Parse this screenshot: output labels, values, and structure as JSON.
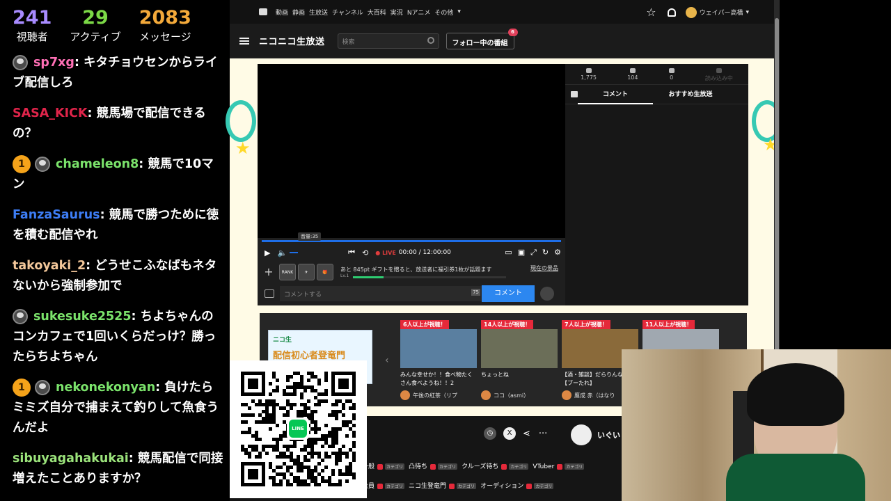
{
  "stats": [
    {
      "value": "241",
      "label": "視聴者",
      "color": "#a88bff"
    },
    {
      "value": "29",
      "label": "アクティブ",
      "color": "#7bd846"
    },
    {
      "value": "2083",
      "label": "メッセージ",
      "color": "#f3a93a"
    }
  ],
  "chat": [
    {
      "name": "sp7xg",
      "color": "#ff6fb5",
      "text": "キタチョウセンからライブ配信しろ",
      "badges": [
        "avatar"
      ]
    },
    {
      "name": "SASA_KICK",
      "color": "#e0244a",
      "text": "競馬場で配信できるの？",
      "badges": []
    },
    {
      "name": "chameleon8",
      "color": "#7be36b",
      "text": "競馬で10マン",
      "badges": [
        "1",
        "avatar"
      ]
    },
    {
      "name": "FanzaSaurus",
      "color": "#3d7df5",
      "text": "競馬で勝つために徳を積む配信やれ",
      "badges": []
    },
    {
      "name": "takoyaki_2",
      "color": "#f3c79a",
      "text": "どうせこふなばもネタないから強制参加で",
      "badges": []
    },
    {
      "name": "sukesuke2525",
      "color": "#7be36b",
      "text": "ちよちゃんのコンカフェで1回いくらだっけ？勝ったらちよちゃん",
      "badges": [
        "avatar"
      ]
    },
    {
      "name": "nekonekonyan",
      "color": "#7be36b",
      "text": "負けたらミミズ自分で捕まえて釣りして魚食うんだよ",
      "badges": [
        "1",
        "avatar"
      ]
    },
    {
      "name": "sibuyagahakukai",
      "color": "#9be37b",
      "text": "競馬配信で同接増えたことありますか？",
      "badges": []
    }
  ],
  "niconav": {
    "items": [
      "動画",
      "静画",
      "生放送",
      "チャンネル",
      "大百科",
      "実況",
      "Nアニメ",
      "その他"
    ],
    "user": "ウェイパー高橋"
  },
  "header": {
    "logo": "ニコニコ生放送",
    "search_placeholder": "検索",
    "follow_label": "フォロー中の番組",
    "follow_count": "6"
  },
  "player": {
    "volume_tip": "音量:35",
    "volume": 35,
    "live": "LIVE",
    "time": "00:00 / 12:00:00",
    "gift_text": "あと 845pt ギフトを贈ると、放送者に福引券1枚が話題ます",
    "gift_level": "Lv.1",
    "gift_now": "現在の景品",
    "comment_placeholder": "コメントする",
    "comment_count": "75",
    "comment_button": "コメント",
    "rank_label": "RANK"
  },
  "side": {
    "stats": [
      "1,775",
      "104",
      "0",
      "読み込み中"
    ],
    "tab_comment": "コメント",
    "tab_recommend": "おすすめ生放送"
  },
  "recs": {
    "ad_title": "ニコ生",
    "ad_sub": "配信初心者登竜門",
    "cards": [
      {
        "label": "6人以上が視聴！",
        "title": "みんな幸せか！！食べ物たくさん食べようね！！2",
        "user": "午後の紅茶（リプ",
        "thumb": "#5a7fa0"
      },
      {
        "label": "14人以上が視聴！",
        "title": "ちょっとね",
        "user": "ココ（asmi）",
        "thumb": "#6b6e58"
      },
      {
        "label": "7人以上が視聴！",
        "title": "【酒・雑談】だらりんなりん【ブーたれ】",
        "user": "鷹成 赤（はなり",
        "thumb": "#8a6a3a"
      },
      {
        "label": "11人以上が視聴！",
        "title": "",
        "user": "",
        "thumb": "#a0a8b0"
      }
    ]
  },
  "bottom": {
    "owner": "いぐい",
    "tags": [
      {
        "text": "一般"
      },
      {
        "text": "凸待ち"
      },
      {
        "text": "クルーズ待ち"
      },
      {
        "text": "VTuber"
      },
      {
        "text": "会員"
      },
      {
        "text": "ニコ生登竜門"
      },
      {
        "text": "オーディション"
      }
    ],
    "cat_label": "カテゴリ"
  },
  "qr": {
    "badge": "LINE"
  }
}
